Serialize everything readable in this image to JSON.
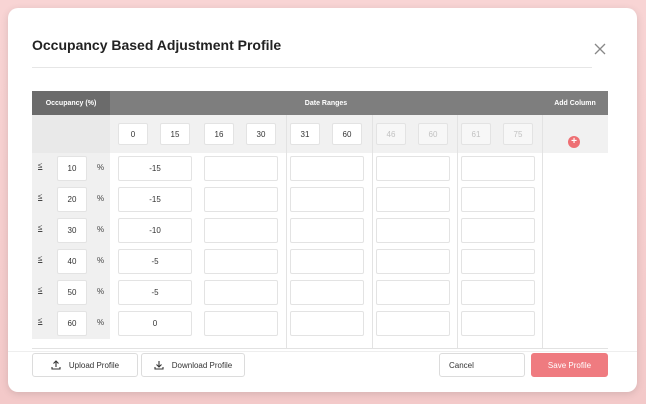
{
  "modal": {
    "title": "Occupancy Based Adjustment Profile"
  },
  "header": {
    "occupancy": "Occupancy (%)",
    "date_ranges": "Date Ranges",
    "add_column": "Add Column"
  },
  "ranges": [
    {
      "from": "0",
      "to": "15",
      "disabled": false
    },
    {
      "from": "16",
      "to": "30",
      "disabled": false
    },
    {
      "from": "31",
      "to": "60",
      "disabled": false
    },
    {
      "from": "46",
      "to": "60",
      "disabled": true
    },
    {
      "from": "61",
      "to": "75",
      "disabled": true
    }
  ],
  "rows": [
    {
      "le": "≤",
      "occ": "10",
      "pct": "%",
      "values": [
        "-15",
        "",
        "",
        "",
        ""
      ]
    },
    {
      "le": "≤",
      "occ": "20",
      "pct": "%",
      "values": [
        "-15",
        "",
        "",
        "",
        ""
      ]
    },
    {
      "le": "≤",
      "occ": "30",
      "pct": "%",
      "values": [
        "-10",
        "",
        "",
        "",
        ""
      ]
    },
    {
      "le": "≤",
      "occ": "40",
      "pct": "%",
      "values": [
        "-5",
        "",
        "",
        "",
        ""
      ]
    },
    {
      "le": "≤",
      "occ": "50",
      "pct": "%",
      "values": [
        "-5",
        "",
        "",
        "",
        ""
      ]
    },
    {
      "le": "≤",
      "occ": "60",
      "pct": "%",
      "values": [
        "0",
        "",
        "",
        "",
        ""
      ]
    }
  ],
  "footer": {
    "upload": "Upload Profile",
    "download": "Download Profile",
    "cancel": "Cancel",
    "save": "Save Profile"
  },
  "colors": {
    "accent": "#ef7b80",
    "header_bg": "#7e7e7e",
    "add_icon": "#ee6f73"
  },
  "icons": {
    "close": "close-icon",
    "add": "plus-circle-icon",
    "upload": "upload-icon",
    "download": "download-icon"
  }
}
